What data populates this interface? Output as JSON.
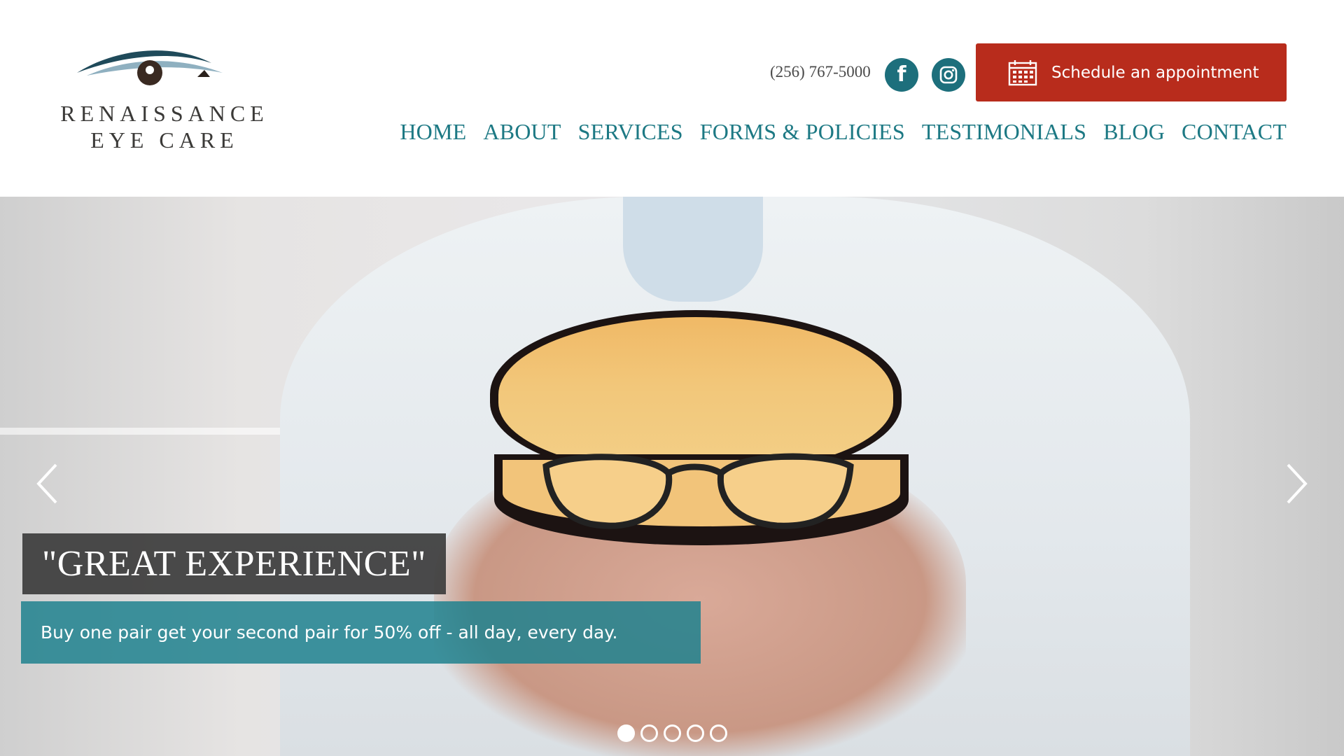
{
  "logo": {
    "line1": "RENAISSANCE",
    "line2": "EYE CARE"
  },
  "header": {
    "phone": "(256) 767-5000",
    "facebook_icon": "facebook-icon",
    "instagram_icon": "instagram-icon",
    "appointment_label": "Schedule an appointment",
    "appointment_icon": "calendar-icon"
  },
  "nav": {
    "items": [
      "HOME",
      "ABOUT",
      "SERVICES",
      "FORMS & POLICIES",
      "TESTIMONIALS",
      "BLOG",
      "CONTACT"
    ]
  },
  "hero": {
    "caption_title": "\"GREAT EXPERIENCE\"",
    "caption_text": "Buy one pair get your second pair for 50% off - all day, every day.",
    "slide_count": 5,
    "active_slide": 1
  },
  "colors": {
    "brand_teal": "#1d7984",
    "button_red": "#b82c1c",
    "caption_dark": "#3c3c3c",
    "caption_teal": "#1f818e"
  }
}
